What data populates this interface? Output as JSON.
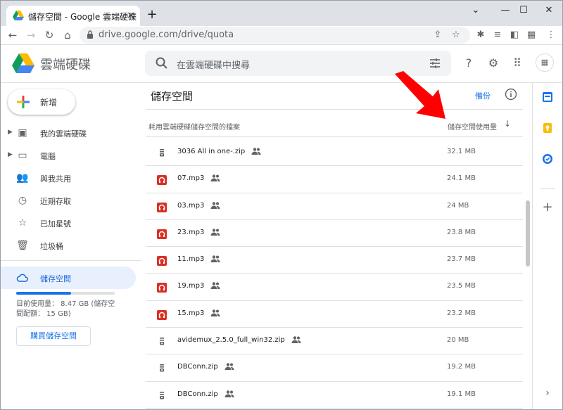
{
  "browser": {
    "tab_title": "儲存空間 - Google 雲端硬碟",
    "tab_close": "×",
    "new_tab": "+",
    "url": "drive.google.com/drive/quota",
    "window_controls": [
      "⌄",
      "—",
      "☐",
      "✕"
    ]
  },
  "header": {
    "brand": "雲端硬碟",
    "search_placeholder": "在雲端硬碟中搜尋"
  },
  "sidebar": {
    "new_label": "新增",
    "items": [
      {
        "label": "我的雲端硬碟",
        "icon": "drive-icon"
      },
      {
        "label": "電腦",
        "icon": "computer-icon"
      },
      {
        "label": "與我共用",
        "icon": "people-icon"
      },
      {
        "label": "近期存取",
        "icon": "clock-icon"
      },
      {
        "label": "已加星號",
        "icon": "star-icon"
      },
      {
        "label": "垃圾桶",
        "icon": "trash-icon"
      },
      {
        "label": "儲存空間",
        "icon": "cloud-icon"
      }
    ],
    "quota_used_fraction": 0.56,
    "quota_text": "目前使用量： 8.47 GB (儲存空間配額： 15 GB)",
    "buy_storage": "購買儲存空間"
  },
  "main": {
    "title": "儲存空間",
    "backup_link": "備份",
    "column_files": "耗用雲端硬碟儲存空間的檔案",
    "column_usage": "儲存空間使用量",
    "sort_arrow": "↓",
    "files": [
      {
        "name": "3036 All in one-.zip",
        "size": "32.1 MB",
        "type": "zip"
      },
      {
        "name": "07.mp3",
        "size": "24.1 MB",
        "type": "audio"
      },
      {
        "name": "03.mp3",
        "size": "24 MB",
        "type": "audio"
      },
      {
        "name": "23.mp3",
        "size": "23.8 MB",
        "type": "audio"
      },
      {
        "name": "11.mp3",
        "size": "23.7 MB",
        "type": "audio"
      },
      {
        "name": "19.mp3",
        "size": "23.5 MB",
        "type": "audio"
      },
      {
        "name": "15.mp3",
        "size": "23.2 MB",
        "type": "audio"
      },
      {
        "name": "avidemux_2.5.0_full_win32.zip",
        "size": "20 MB",
        "type": "zip"
      },
      {
        "name": "DBConn.zip",
        "size": "19.2 MB",
        "type": "zip"
      },
      {
        "name": "DBConn.zip",
        "size": "19.1 MB",
        "type": "zip"
      }
    ]
  },
  "colors": {
    "accent": "#1a73e8",
    "audio_icon": "#d93025",
    "annotation_arrow": "#ff0000"
  }
}
